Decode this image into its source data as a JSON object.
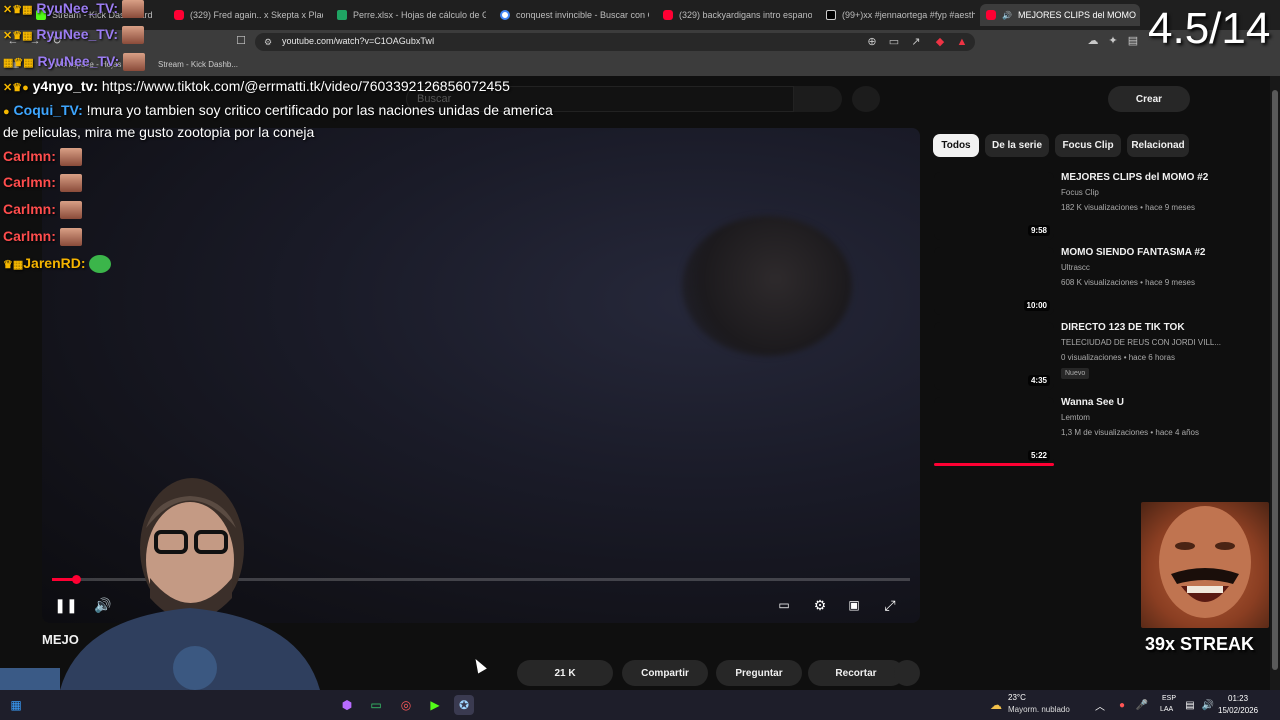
{
  "browser": {
    "tabs": [
      {
        "label": "Stream - Kick Dashboard",
        "favicon": "kick-icon"
      },
      {
        "label": "(329) Fred again.. x Skepta x Plaquebo",
        "favicon": "youtube-icon"
      },
      {
        "label": "Perre.xlsx - Hojas de cálculo de Goog",
        "favicon": "sheets-icon"
      },
      {
        "label": "conquest invincible - Buscar con Goo",
        "favicon": "google-icon"
      },
      {
        "label": "(329) backyardigans intro espanol la",
        "favicon": "youtube-icon"
      },
      {
        "label": "(99+)xx #jennaortega #fyp #aesthet",
        "favicon": "tiktok-icon"
      },
      {
        "label": "MEJORES CLIPS del MOMO",
        "favicon": "youtube-icon"
      }
    ],
    "url": "youtube.com/watch?v=C1OAGubxTwI",
    "bookmarks": [
      "Workspace - Hojas de...",
      "Stream - Kick Dashb..."
    ]
  },
  "youtube": {
    "search_placeholder": "Buscar",
    "create_label": "Crear",
    "chips": [
      "Todos",
      "De la serie",
      "Focus Clip",
      "Relacionad"
    ],
    "video_title_peek": "MEJO",
    "likes": "21 K",
    "share": "Compartir",
    "ask": "Preguntar",
    "clip": "Recortar",
    "progress": 0.028,
    "recommendations": [
      {
        "title": "MEJORES CLIPS del MOMO #2",
        "channel": "Focus Clip",
        "meta": "182 K visualizaciones • hace 9 meses",
        "duration": "9:58",
        "badge": ""
      },
      {
        "title": "MOMO SIENDO FANTASMA #2",
        "channel": "Ultrascc",
        "meta": "608 K visualizaciones • hace 9 meses",
        "duration": "10:00",
        "badge": ""
      },
      {
        "title": "DIRECTO 123 DE TIK TOK",
        "channel": "TELECIUDAD DE REUS CON JORDI VILL...",
        "meta": "0 visualizaciones • hace 6 horas",
        "duration": "4:35",
        "badge": "Nuevo"
      },
      {
        "title": "Wanna See U",
        "channel": "Lemtom",
        "meta": "1,3 M de visualizaciones • hace 4 años",
        "duration": "5:22",
        "badge": ""
      }
    ]
  },
  "chat": [
    {
      "user": "RyuNee_TV:",
      "color": "#9b7cf2",
      "text": ""
    },
    {
      "user": "RyuNee_TV:",
      "color": "#9b7cf2",
      "text": ""
    },
    {
      "user": "RyuNee_TV:",
      "color": "#9b7cf2",
      "text": ""
    },
    {
      "user": "y4nyo_tv:",
      "color": "#ffffff",
      "text": "https://www.tiktok.com/@errmatti.tk/video/7603392126856072455"
    },
    {
      "user": "Coqui_TV:",
      "color": "#3ea6ff",
      "text": "!mura yo tambien soy critico certificado por las naciones unidas de america"
    },
    {
      "user": "",
      "color": "#ffffff",
      "text": "de peliculas, mira me gusto zootopia por la coneja"
    },
    {
      "user": "Carlmn:",
      "color": "#ff4d4d",
      "text": ""
    },
    {
      "user": "Carlmn:",
      "color": "#ff4d4d",
      "text": ""
    },
    {
      "user": "Carlmn:",
      "color": "#ff4d4d",
      "text": ""
    },
    {
      "user": "Carlmn:",
      "color": "#ff4d4d",
      "text": ""
    },
    {
      "user": "JarenRD:",
      "color": "#f5b400",
      "text": ""
    }
  ],
  "overlay": {
    "counter": "4.5/14",
    "streak": "39x STREAK"
  },
  "taskbar": {
    "temp": "23°C",
    "weather": "Mayorm. nublado",
    "lang1": "ESP",
    "lang2": "LAA",
    "time": "01:23",
    "date": "15/02/2026"
  }
}
